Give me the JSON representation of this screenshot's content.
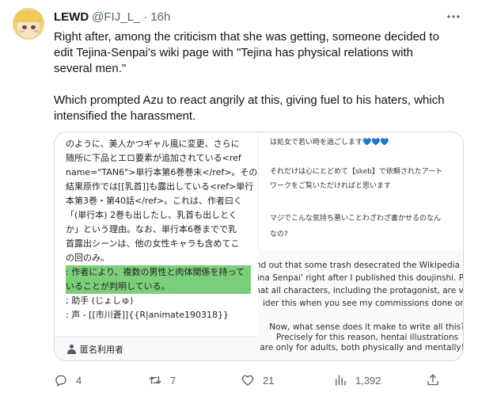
{
  "tweet": {
    "author": {
      "display_name": "LEWD",
      "handle": "@FIJ_L_",
      "separator": "·",
      "time": "16h"
    },
    "text": {
      "paragraph1": [
        "Right after, among the criticism that she was getting, someone decided to",
        "edit Tejina-Senpai's wiki page with \"Tejina has physical relations with",
        "several men.\""
      ],
      "paragraph2": [
        "Which prompted Azu to react angrily at this, giving fuel to his haters, which",
        "intensified the harassment."
      ]
    },
    "more_icon": "ellipsis-icon"
  },
  "media": {
    "wiki_lines": [
      "のように、美人かつギャル風に変更、さらに",
      "随所に下品とエロ要素が追加されている<ref",
      "name=\"TAN6\">単行本第6巻巻末</ref>。その",
      "結果原作では[[乳首]]も露出している<ref>単行",
      "本第3巻・第40話</ref>。これは、作者曰く",
      "「(単行本) 2巻も出したし、乳首も出しとく",
      "か」という理由。なお、単行本6巻までで乳",
      "首露出シーンは、他の女性キャラも含めてこ",
      "の回のみ。",
      ": 作者により、複数の男性と肉体関係を持って",
      "いることが判明している。",
      "; 助手 (じょしゅ)",
      ": 声 - [[市川蒼]]{{R|animate190318}}"
    ],
    "highlight_color": "#7ccf7a",
    "wiki_user": "匿名利用者",
    "user_icon": "user-icon",
    "right_top": {
      "line1": "は処女で若い時を過ごします",
      "hearts": "💙💙💙",
      "line2": "それだけは心にとどめて【skeb】で依頼されたアート",
      "line3": "ワークをご覧いただければと思います",
      "line4": "マジでこんな気持ち悪いことわざわざ書かせるのなん",
      "line5": "なの?"
    },
    "right_bottom": [
      "nd out that some trash desecrated the Wikipedia",
      "jina Senpai' right after I published this doujinshi. P",
      "hat all characters, including the protagonist, are v",
      "ider this when you see my commissions done on",
      "Now, what sense does it make to write all this?",
      "Precisely for this reason, hentai illustrations",
      "are only for adults, both physically and mentally!\""
    ]
  },
  "actions": {
    "reply": {
      "icon": "reply-icon",
      "count": "4"
    },
    "retweet": {
      "icon": "retweet-icon",
      "count": "7"
    },
    "like": {
      "icon": "heart-icon",
      "count": "21"
    },
    "views": {
      "icon": "views-icon",
      "count": "1,392"
    },
    "share": {
      "icon": "share-icon"
    }
  }
}
